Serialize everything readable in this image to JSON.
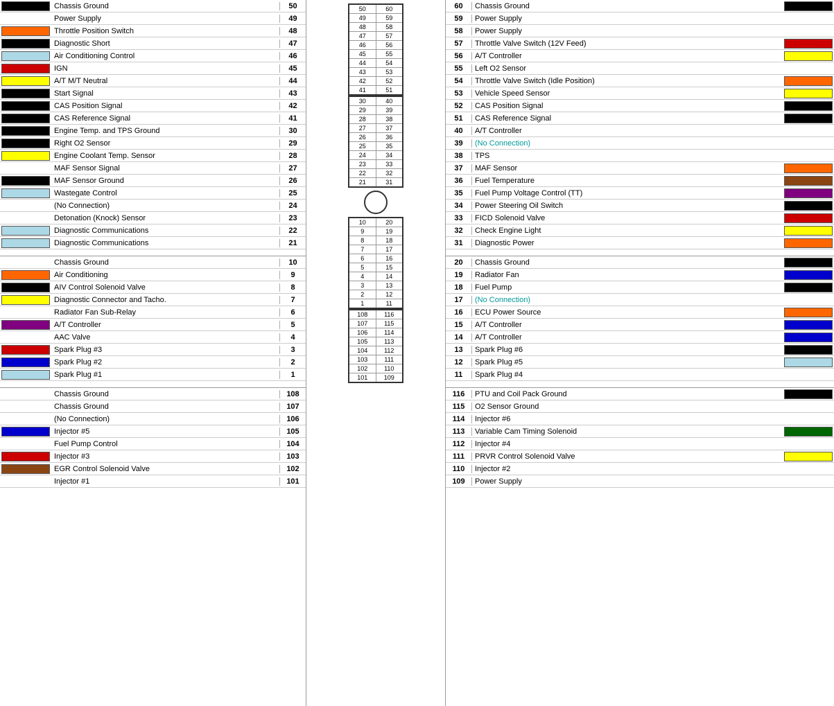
{
  "left": {
    "rows_top": [
      {
        "num": 50,
        "label": "Chassis Ground",
        "color": "#000000"
      },
      {
        "num": 49,
        "label": "Power Supply",
        "color": "transparent"
      },
      {
        "num": 48,
        "label": "Throttle Position Switch",
        "color": "#FF6600"
      },
      {
        "num": 47,
        "label": "Diagnostic Short",
        "color": "#000000"
      },
      {
        "num": 46,
        "label": "Air Conditioning Control",
        "color": "#ADD8E6"
      },
      {
        "num": 45,
        "label": "IGN",
        "color": "#CC0000"
      },
      {
        "num": 44,
        "label": "A/T M/T Neutral",
        "color": "#FFFF00"
      },
      {
        "num": 43,
        "label": "Start Signal",
        "color": "#000000"
      },
      {
        "num": 42,
        "label": "CAS Position Signal",
        "color": "#000000"
      },
      {
        "num": 41,
        "label": "CAS Reference Signal",
        "color": "#000000"
      },
      {
        "num": 30,
        "label": "Engine Temp. and TPS Ground",
        "color": "#000000"
      },
      {
        "num": 29,
        "label": "Right O2 Sensor",
        "color": "#000000"
      },
      {
        "num": 28,
        "label": "Engine Coolant Temp. Sensor",
        "color": "#FFFF00"
      },
      {
        "num": 27,
        "label": "MAF Sensor Signal",
        "color": "transparent"
      },
      {
        "num": 26,
        "label": "MAF Sensor Ground",
        "color": "#000000"
      },
      {
        "num": 25,
        "label": "Wastegate Control",
        "color": "#ADD8E6"
      },
      {
        "num": 24,
        "label": "(No Connection)",
        "color": "transparent"
      },
      {
        "num": 23,
        "label": "Detonation (Knock) Sensor",
        "color": "transparent"
      },
      {
        "num": 22,
        "label": "Diagnostic Communications",
        "color": "#ADD8E6"
      },
      {
        "num": 21,
        "label": "Diagnostic Communications",
        "color": "#ADD8E6"
      }
    ],
    "rows_mid": [
      {
        "num": 10,
        "label": "Chassis Ground",
        "color": "transparent"
      },
      {
        "num": 9,
        "label": "Air Conditioning",
        "color": "#FF6600"
      },
      {
        "num": 8,
        "label": "AIV Control Solenoid Valve",
        "color": "#000000"
      },
      {
        "num": 7,
        "label": "Diagnostic Connector and Tacho.",
        "color": "#FFFF00"
      },
      {
        "num": 6,
        "label": "Radiator Fan Sub-Relay",
        "color": "transparent"
      },
      {
        "num": 5,
        "label": "A/T Controller",
        "color": "#800080"
      },
      {
        "num": 4,
        "label": "AAC Valve",
        "color": "transparent"
      },
      {
        "num": 3,
        "label": "Spark Plug #3",
        "color": "#CC0000"
      },
      {
        "num": 2,
        "label": "Spark Plug #2",
        "color": "#0000CC"
      },
      {
        "num": 1,
        "label": "Spark Plug #1",
        "color": "#ADD8E6"
      }
    ],
    "rows_bot": [
      {
        "num": 108,
        "label": "Chassis Ground",
        "color": "transparent"
      },
      {
        "num": 107,
        "label": "Chassis Ground",
        "color": "transparent"
      },
      {
        "num": 106,
        "label": "(No Connection)",
        "color": "transparent"
      },
      {
        "num": 105,
        "label": "Injector #5",
        "color": "#0000CC"
      },
      {
        "num": 104,
        "label": "Fuel Pump Control",
        "color": "transparent"
      },
      {
        "num": 103,
        "label": "Injector #3",
        "color": "#CC0000"
      },
      {
        "num": 102,
        "label": "EGR Control Solenoid Valve",
        "color": "#8B4513"
      },
      {
        "num": 101,
        "label": "Injector #1",
        "color": "transparent"
      }
    ]
  },
  "right": {
    "rows_top": [
      {
        "num": 60,
        "label": "Chassis Ground",
        "color": "#000000"
      },
      {
        "num": 59,
        "label": "Power Supply",
        "color": "transparent"
      },
      {
        "num": 58,
        "label": "Power Supply",
        "color": "transparent"
      },
      {
        "num": 57,
        "label": "Throttle Valve Switch (12V Feed)",
        "color": "#CC0000"
      },
      {
        "num": 56,
        "label": "A/T Controller",
        "color": "#FFFF00"
      },
      {
        "num": 55,
        "label": "Left O2 Sensor",
        "color": "transparent"
      },
      {
        "num": 54,
        "label": "Throttle Valve Switch (Idle Position)",
        "color": "#FF6600"
      },
      {
        "num": 53,
        "label": "Vehicle Speed Sensor",
        "color": "#FFFF00"
      },
      {
        "num": 52,
        "label": "CAS Position Signal",
        "color": "#000000"
      },
      {
        "num": 51,
        "label": "CAS Reference Signal",
        "color": "#000000"
      },
      {
        "num": 40,
        "label": "A/T Controller",
        "color": "transparent"
      },
      {
        "num": 39,
        "label": "(No Connection)",
        "color": "transparent",
        "noconn": true
      },
      {
        "num": 38,
        "label": "TPS",
        "color": "transparent"
      },
      {
        "num": 37,
        "label": "MAF Sensor",
        "color": "#FF6600"
      },
      {
        "num": 36,
        "label": "Fuel Temperature",
        "color": "#8B4513"
      },
      {
        "num": 35,
        "label": "Fuel Pump Voltage Control (TT)",
        "color": "#800080"
      },
      {
        "num": 34,
        "label": "Power Steering Oil Switch",
        "color": "#000000"
      },
      {
        "num": 33,
        "label": "FICD Solenoid Valve",
        "color": "#CC0000"
      },
      {
        "num": 32,
        "label": "Check Engine Light",
        "color": "#FFFF00"
      },
      {
        "num": 31,
        "label": "Diagnostic Power",
        "color": "#FF6600"
      }
    ],
    "rows_mid": [
      {
        "num": 20,
        "label": "Chassis Ground",
        "color": "#000000"
      },
      {
        "num": 19,
        "label": "Radiator Fan",
        "color": "#0000CC"
      },
      {
        "num": 18,
        "label": "Fuel Pump",
        "color": "#000000"
      },
      {
        "num": 17,
        "label": "(No Connection)",
        "color": "transparent",
        "noconn": true
      },
      {
        "num": 16,
        "label": "ECU Power Source",
        "color": "#FF6600"
      },
      {
        "num": 15,
        "label": "A/T Controller",
        "color": "#0000CC"
      },
      {
        "num": 14,
        "label": "A/T Controller",
        "color": "#0000CC"
      },
      {
        "num": 13,
        "label": "Spark Plug #6",
        "color": "#000000"
      },
      {
        "num": 12,
        "label": "Spark Plug #5",
        "color": "#ADD8E6"
      },
      {
        "num": 11,
        "label": "Spark Plug #4",
        "color": "transparent"
      }
    ],
    "rows_bot": [
      {
        "num": 116,
        "label": "PTU and Coil Pack Ground",
        "color": "#000000"
      },
      {
        "num": 115,
        "label": "O2 Sensor Ground",
        "color": "transparent"
      },
      {
        "num": 114,
        "label": "Injector #6",
        "color": "transparent"
      },
      {
        "num": 113,
        "label": "Variable Cam Timing Solenoid",
        "color": "#006600"
      },
      {
        "num": 112,
        "label": "Injector #4",
        "color": "transparent"
      },
      {
        "num": 111,
        "label": "PRVR Control Solenoid Valve",
        "color": "#FFFF00"
      },
      {
        "num": 110,
        "label": "Injector #2",
        "color": "transparent"
      },
      {
        "num": 109,
        "label": "Power Supply",
        "color": "transparent"
      }
    ]
  },
  "center": {
    "top_pairs": [
      [
        50,
        60
      ],
      [
        49,
        59
      ],
      [
        48,
        58
      ],
      [
        47,
        57
      ],
      [
        46,
        56
      ],
      [
        45,
        55
      ],
      [
        44,
        54
      ],
      [
        43,
        53
      ],
      [
        42,
        52
      ],
      [
        41,
        51
      ]
    ],
    "mid_pairs_a": [
      [
        30,
        40
      ],
      [
        29,
        39
      ],
      [
        28,
        38
      ],
      [
        27,
        37
      ],
      [
        26,
        36
      ],
      [
        25,
        35
      ],
      [
        24,
        34
      ],
      [
        23,
        33
      ],
      [
        22,
        32
      ],
      [
        21,
        31
      ]
    ],
    "mid_pairs_b": [
      [
        10,
        20
      ],
      [
        9,
        19
      ],
      [
        8,
        18
      ],
      [
        7,
        17
      ],
      [
        6,
        16
      ],
      [
        5,
        15
      ],
      [
        4,
        14
      ],
      [
        3,
        13
      ],
      [
        2,
        12
      ],
      [
        1,
        11
      ]
    ],
    "bot_pairs": [
      [
        108,
        116
      ],
      [
        107,
        115
      ],
      [
        106,
        114
      ],
      [
        105,
        113
      ],
      [
        104,
        112
      ],
      [
        103,
        111
      ],
      [
        102,
        110
      ],
      [
        101,
        109
      ]
    ]
  }
}
